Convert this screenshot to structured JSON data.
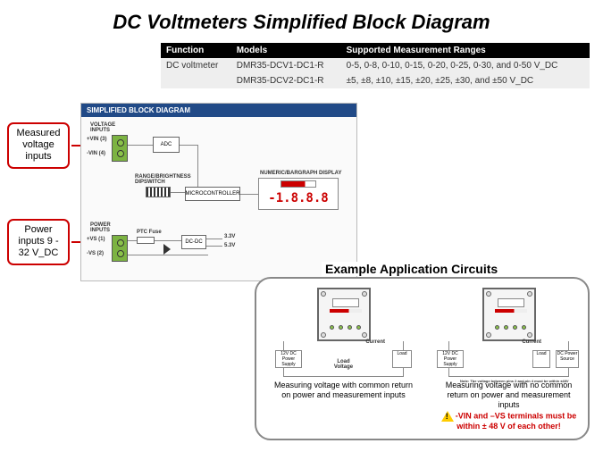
{
  "title": "DC Voltmeters Simplified Block Diagram",
  "table": {
    "headers": [
      "Function",
      "Models",
      "Supported Measurement Ranges"
    ],
    "rows": [
      {
        "func": "DC voltmeter",
        "model": "DMR35-DCV1-DC1-R",
        "ranges": "0-5, 0-8, 0-10, 0-15, 0-20, 0-25, 0-30, and 0-50 V_DC"
      },
      {
        "func": "",
        "model": "DMR35-DCV2-DC1-R",
        "ranges": "±5, ±8, ±10, ±15, ±20, ±25, ±30, and ±50 V_DC"
      }
    ]
  },
  "block_diagram": {
    "header": "SIMPLIFIED BLOCK DIAGRAM",
    "voltage_inputs_label": "VOLTAGE\nINPUTS",
    "vin_plus": "+VIN (3)",
    "vin_minus": "-VIN (4)",
    "adc": "ADC",
    "dipswitch_label": "RANGE/BRIGHTNESS\nDIPSWITCH",
    "microcontroller": "MICROCONTROLLER",
    "display_label": "NUMERIC/BARGRAPH DISPLAY",
    "display_value": "-1.8.8.8",
    "power_inputs_label": "POWER\nINPUTS",
    "vs_plus": "+VS (1)",
    "vs_minus": "-VS (2)",
    "ptc_fuse": "PTC Fuse",
    "dcdc": "DC-DC",
    "v33": "3.3V",
    "v53": "5.3V"
  },
  "callouts": {
    "measured": "Measured\nvoltage\ninputs",
    "power": "Power\ninputs\n9 - 32 V_DC"
  },
  "example": {
    "title": "Example Application Circuits",
    "left_caption": "Measuring voltage with common return on power and measurement inputs",
    "right_caption": "Measuring voltage with no common return on power and measurement inputs",
    "warning": "-VIN and –VS terminals must be within ± 48 V of each other!",
    "src_box": "12V DC\nPower\nSupply",
    "load_box": "Load",
    "dc_src": "DC\nPower\nSource",
    "current_lbl": "Current",
    "voltage_lbl": "Load\nVoltage",
    "note": "Note: The voltage between pins 2 and pin 4 must be within ±48V"
  }
}
